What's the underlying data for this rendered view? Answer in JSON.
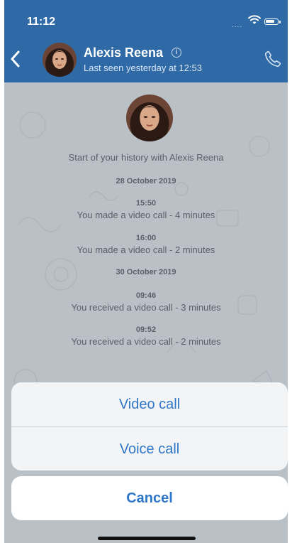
{
  "status_bar": {
    "time": "11:12",
    "signal": "....",
    "battery_level": 0.8
  },
  "header": {
    "contact_name": "Alexis Reena",
    "last_seen": "Last seen yesterday at 12:53",
    "info_glyph": "i",
    "icons": [
      "back-chevron-icon",
      "info-icon",
      "phone-icon"
    ]
  },
  "chat": {
    "history_start": "Start of your history with Alexis Reena",
    "groups": [
      {
        "date": "28 October 2019",
        "entries": [
          {
            "time": "15:50",
            "text": "You made a video call - 4 minutes"
          },
          {
            "time": "16:00",
            "text": "You made a video call - 2 minutes"
          }
        ]
      },
      {
        "date": "30 October 2019",
        "entries": [
          {
            "time": "09:46",
            "text": "You received a video call - 3 minutes"
          },
          {
            "time": "09:52",
            "text": "You received a video call - 2 minutes"
          }
        ]
      }
    ]
  },
  "action_sheet": {
    "options": [
      "Video call",
      "Voice call"
    ],
    "cancel": "Cancel"
  },
  "colors": {
    "header": "#2f6aa6",
    "accent": "#2f77c8",
    "chat_bg": "#b9c0c6"
  }
}
